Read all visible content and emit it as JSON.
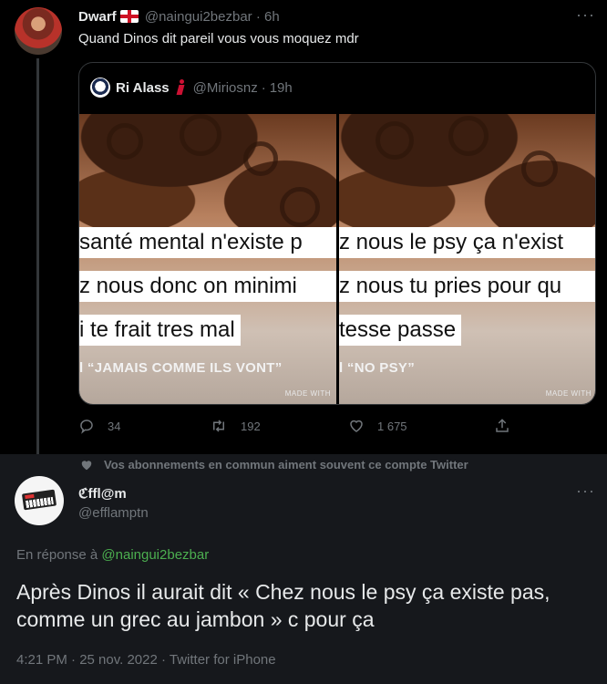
{
  "parent_tweet": {
    "display_name": "Dwarf",
    "handle": "@naingui2bezbar",
    "separator": "·",
    "time": "6h",
    "text": "Quand Dinos dit pareil vous vous moquez mdr",
    "more": "···"
  },
  "quoted_tweet": {
    "display_name": "Ri Alass",
    "handle": "@Miriosnz",
    "separator": "·",
    "time": "19h",
    "media": [
      {
        "caption_lines": [
          "santé mental n'existe p",
          "z nous donc on minimi",
          "i te frait tres mal"
        ],
        "song": "l “JAMAIS COMME ILS VONT”",
        "watermark": "MADE WITH"
      },
      {
        "caption_lines": [
          "z nous le psy ça n'exist",
          "z nous tu pries pour qu",
          "tesse passe"
        ],
        "song": "l “NO PSY”",
        "watermark": "MADE WITH"
      }
    ]
  },
  "actions": {
    "replies": "34",
    "retweets": "192",
    "likes": "1 675"
  },
  "social_context": "Vos abonnements en commun aiment souvent ce compte Twitter",
  "reply_tweet": {
    "display_name": "ℭffl@m",
    "handle": "@efflamptn",
    "more": "···",
    "in_reply_prefix": "En réponse à",
    "in_reply_handle": "@naingui2bezbar",
    "text": "Après Dinos il aurait dit « Chez nous le psy ça existe pas, comme un grec au jambon » c pour ça",
    "meta": "4:21 PM · 25 nov. 2022 · Twitter for iPhone"
  },
  "colors": {
    "background": "#000000",
    "reply_background": "#16181c",
    "muted": "#71767b",
    "link_green": "#4caf50"
  }
}
